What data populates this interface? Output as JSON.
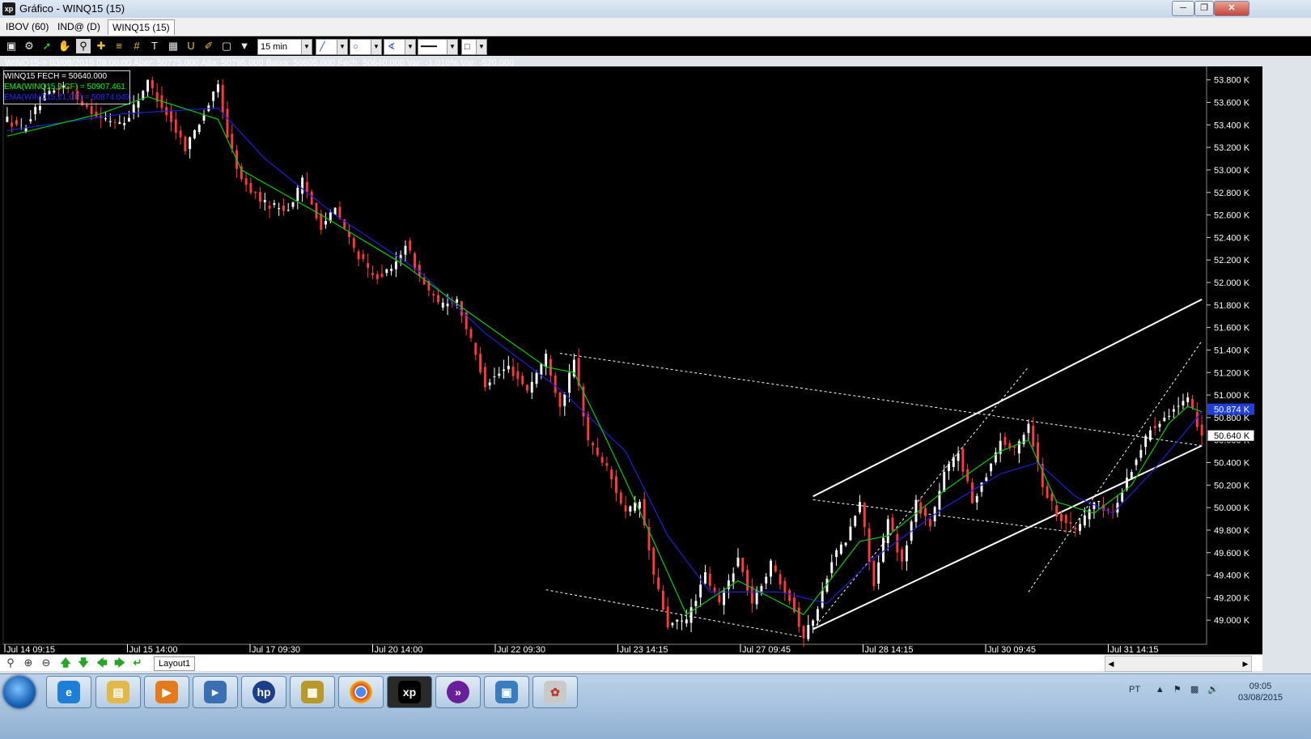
{
  "window": {
    "title": "Gráfico - WINQ15 (15)",
    "app_icon": "xp",
    "controls": [
      "minimize",
      "maximize",
      "close"
    ]
  },
  "tabs": [
    {
      "label": "IBOV (60)"
    },
    {
      "label": "IND@ (D)"
    },
    {
      "label": "WINQ15 (15)",
      "active": true
    }
  ],
  "toolbar": {
    "icons": [
      "chart-type-icon",
      "gear-icon",
      "draw-icon",
      "hand-icon",
      "zoom-area-icon",
      "crosshair-icon",
      "hash-icon",
      "hash-alt-icon",
      "text-icon",
      "table-icon",
      "magnet-icon",
      "brush-icon",
      "clipboard-icon",
      "filter-icon"
    ],
    "period": "15 min"
  },
  "info": {
    "text": "WINQ15-> 03/08/2015 09:00:00 Aber: 50775,000 Alta: 50795,000 Baixa: 50605,000 Fech: 50640,000 Var: -1,016% Var: -520,000"
  },
  "legend": [
    {
      "text": "WINQ15 FECH = 50640.000",
      "color": "#ffffff"
    },
    {
      "text": "EMA(WINQ15,9,CF) = 50907.461",
      "color": "#00ff00"
    },
    {
      "text": "EMA(WINQ15,21,CF) = 50874.049",
      "color": "#2a2aff"
    }
  ],
  "chart_data": {
    "type": "candlestick",
    "y_axis": {
      "ticks": [
        "53.800 K",
        "53.600 K",
        "53.400 K",
        "53.200 K",
        "53.000 K",
        "52.800 K",
        "52.600 K",
        "52.400 K",
        "52.200 K",
        "52.000 K",
        "51.800 K",
        "51.600 K",
        "51.400 K",
        "51.200 K",
        "51.000 K",
        "50.800 K",
        "50.600 K",
        "50.400 K",
        "50.200 K",
        "50.000 K",
        "49.800 K",
        "49.600 K",
        "49.400 K",
        "49.200 K",
        "49.000 K"
      ],
      "range": [
        48800,
        53920
      ]
    },
    "x_axis": {
      "labels": [
        "Jul 14 09:15",
        "Jul 15 14:00",
        "Jul 17 09:30",
        "Jul 20 14:00",
        "Jul 22 09:30",
        "Jul 23 14:15",
        "Jul 27 09:45",
        "Jul 28 14:15",
        "Jul 30 09:45",
        "Jul 31 14:15"
      ]
    },
    "price_label": "50.640 K",
    "ema21_label": "50.874 K",
    "colors": {
      "up": "#ffffff",
      "down": "#ff3b3b",
      "ema9": "#00cc00",
      "ema21": "#1f1fd6",
      "trendline": "#ffffff",
      "background": "#000000"
    },
    "keypoints": [
      [
        0,
        53450
      ],
      [
        3,
        53350
      ],
      [
        8,
        53650
      ],
      [
        12,
        53750
      ],
      [
        16,
        53600
      ],
      [
        20,
        53450
      ],
      [
        25,
        53420
      ],
      [
        30,
        53780
      ],
      [
        34,
        53500
      ],
      [
        38,
        53200
      ],
      [
        42,
        53500
      ],
      [
        45,
        53750
      ],
      [
        47,
        53300
      ],
      [
        50,
        52900
      ],
      [
        55,
        52700
      ],
      [
        60,
        52650
      ],
      [
        63,
        52900
      ],
      [
        67,
        52500
      ],
      [
        70,
        52650
      ],
      [
        74,
        52300
      ],
      [
        78,
        52050
      ],
      [
        82,
        52100
      ],
      [
        85,
        52350
      ],
      [
        88,
        52050
      ],
      [
        92,
        51800
      ],
      [
        96,
        51850
      ],
      [
        98,
        51600
      ],
      [
        102,
        51100
      ],
      [
        107,
        51250
      ],
      [
        111,
        51050
      ],
      [
        115,
        51350
      ],
      [
        118,
        50900
      ],
      [
        121,
        51300
      ],
      [
        124,
        50600
      ],
      [
        128,
        50350
      ],
      [
        132,
        49950
      ],
      [
        135,
        50050
      ],
      [
        138,
        49400
      ],
      [
        141,
        48950
      ],
      [
        145,
        49000
      ],
      [
        149,
        49400
      ],
      [
        152,
        49150
      ],
      [
        156,
        49550
      ],
      [
        159,
        49150
      ],
      [
        163,
        49500
      ],
      [
        167,
        49200
      ],
      [
        170,
        48850
      ],
      [
        173,
        49100
      ],
      [
        176,
        49550
      ],
      [
        179,
        49700
      ],
      [
        182,
        50050
      ],
      [
        185,
        49300
      ],
      [
        188,
        49900
      ],
      [
        191,
        49500
      ],
      [
        194,
        50050
      ],
      [
        197,
        49850
      ],
      [
        200,
        50300
      ],
      [
        203,
        50500
      ],
      [
        206,
        50050
      ],
      [
        209,
        50300
      ],
      [
        212,
        50600
      ],
      [
        215,
        50500
      ],
      [
        218,
        50750
      ],
      [
        221,
        50200
      ],
      [
        224,
        49950
      ],
      [
        228,
        49800
      ],
      [
        232,
        50050
      ],
      [
        236,
        49950
      ],
      [
        240,
        50350
      ],
      [
        244,
        50700
      ],
      [
        248,
        50850
      ],
      [
        252,
        50950
      ],
      [
        255,
        50650
      ]
    ],
    "ema9": [
      [
        0,
        53300
      ],
      [
        20,
        53500
      ],
      [
        30,
        53650
      ],
      [
        45,
        53450
      ],
      [
        50,
        53000
      ],
      [
        67,
        52600
      ],
      [
        85,
        52150
      ],
      [
        98,
        51750
      ],
      [
        115,
        51250
      ],
      [
        121,
        51200
      ],
      [
        128,
        50600
      ],
      [
        138,
        49700
      ],
      [
        145,
        49050
      ],
      [
        156,
        49350
      ],
      [
        170,
        49050
      ],
      [
        182,
        49700
      ],
      [
        188,
        49750
      ],
      [
        200,
        50150
      ],
      [
        212,
        50500
      ],
      [
        218,
        50600
      ],
      [
        224,
        50050
      ],
      [
        232,
        49950
      ],
      [
        240,
        50200
      ],
      [
        248,
        50750
      ],
      [
        252,
        50900
      ],
      [
        255,
        50850
      ]
    ],
    "ema21": [
      [
        0,
        53350
      ],
      [
        25,
        53500
      ],
      [
        45,
        53550
      ],
      [
        55,
        53100
      ],
      [
        70,
        52600
      ],
      [
        88,
        52100
      ],
      [
        102,
        51550
      ],
      [
        118,
        51050
      ],
      [
        132,
        50500
      ],
      [
        141,
        49750
      ],
      [
        150,
        49250
      ],
      [
        165,
        49250
      ],
      [
        175,
        49150
      ],
      [
        185,
        49550
      ],
      [
        200,
        50000
      ],
      [
        212,
        50300
      ],
      [
        220,
        50400
      ],
      [
        228,
        50100
      ],
      [
        236,
        49950
      ],
      [
        244,
        50300
      ],
      [
        252,
        50700
      ],
      [
        255,
        50850
      ]
    ],
    "trendlines": [
      {
        "style": "solid",
        "points": [
          [
            172,
            50100
          ],
          [
            255,
            51850
          ]
        ]
      },
      {
        "style": "solid",
        "points": [
          [
            172,
            48920
          ],
          [
            255,
            50550
          ]
        ]
      },
      {
        "style": "dashed",
        "points": [
          [
            118,
            51370
          ],
          [
            255,
            50550
          ]
        ]
      },
      {
        "style": "dashed",
        "points": [
          [
            115,
            49270
          ],
          [
            170,
            48850
          ]
        ]
      },
      {
        "style": "dashed",
        "points": [
          [
            172,
            50070
          ],
          [
            228,
            49780
          ]
        ]
      },
      {
        "style": "dashed",
        "points": [
          [
            172,
            48920
          ],
          [
            218,
            51250
          ]
        ]
      },
      {
        "style": "dashed",
        "points": [
          [
            218,
            49250
          ],
          [
            255,
            51480
          ]
        ]
      }
    ]
  },
  "bottom": {
    "layout_tab": "Layout1"
  },
  "taskbar": {
    "apps": [
      "internet-explorer-icon",
      "file-explorer-icon",
      "media-player-icon",
      "network-icon",
      "hp-icon",
      "archive-icon",
      "chrome-icon",
      "xp-icon",
      "forward-app-icon",
      "image-viewer-icon",
      "paint-icon"
    ],
    "lang": "PT",
    "time": "09:05",
    "date": "03/08/2015"
  }
}
